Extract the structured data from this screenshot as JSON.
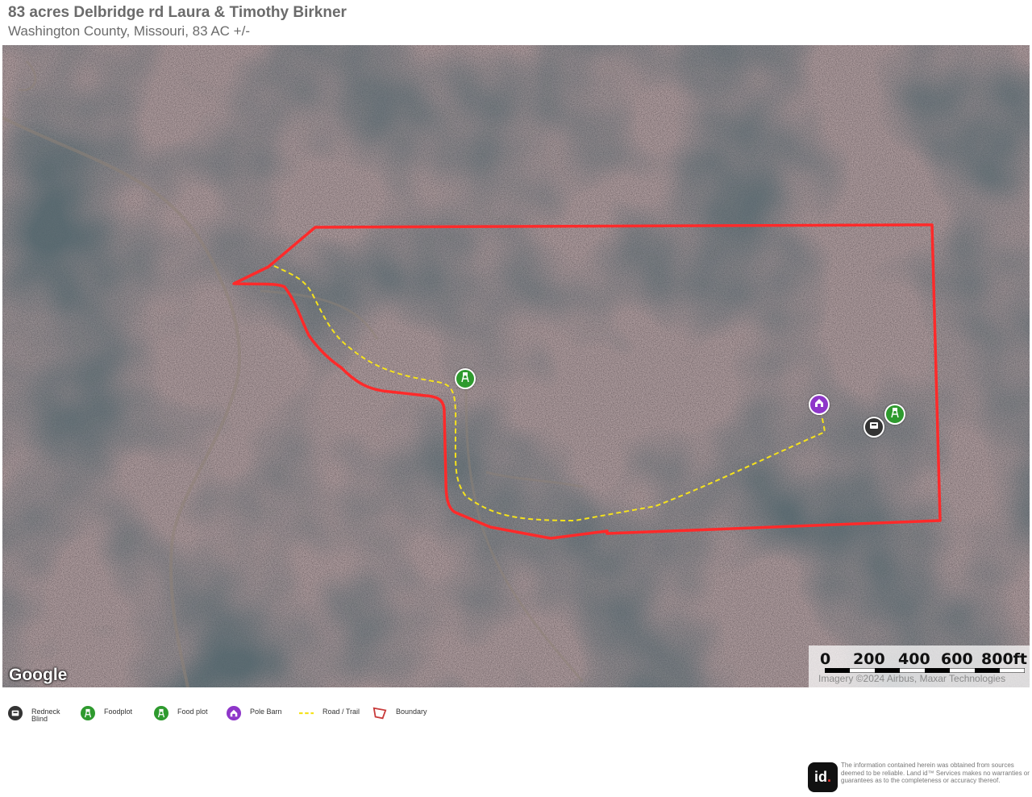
{
  "header": {
    "title": "83 acres Delbridge rd Laura & Timothy Birkner",
    "subtitle": "Washington County, Missouri, 83 AC +/-"
  },
  "map": {
    "provider_logo": "Google",
    "attribution": "Imagery ©2024 Airbus, Maxar Technologies",
    "scale": {
      "labels": [
        "0",
        "200",
        "400",
        "600",
        "800ft"
      ]
    },
    "boundary_color": "#ff2a2a",
    "trail_color": "#f5e21c",
    "markers": [
      {
        "type": "Foodplot",
        "icon": "tree-stand-icon",
        "color": "#2e9a2e"
      },
      {
        "type": "Pole Barn",
        "icon": "barn-icon",
        "color": "#8e36c9"
      },
      {
        "type": "Food plot",
        "icon": "tree-stand-icon",
        "color": "#2e9a2e"
      },
      {
        "type": "Redneck Blind",
        "icon": "blind-icon",
        "color": "#333333"
      }
    ]
  },
  "legend": {
    "items": [
      {
        "label": "Redneck Blind",
        "icon": "blind-icon",
        "color": "#333333"
      },
      {
        "label": "Foodplot",
        "icon": "tree-stand-icon",
        "color": "#2e9a2e"
      },
      {
        "label": "Food plot",
        "icon": "tree-stand-icon",
        "color": "#2e9a2e"
      },
      {
        "label": "Pole Barn",
        "icon": "barn-icon",
        "color": "#8e36c9"
      },
      {
        "label": "Road / Trail",
        "icon": "dashed-line-icon",
        "color": "#f5e21c"
      },
      {
        "label": "Boundary",
        "icon": "boundary-polygon-icon",
        "color": "#c83a3a"
      }
    ]
  },
  "footer": {
    "logo_text": "id",
    "logo_dot": ".",
    "disclaimer": "The information contained herein was obtained from sources deemed to be reliable. Land id™ Services makes no warranties or guarantees as to the completeness or accuracy thereof."
  }
}
